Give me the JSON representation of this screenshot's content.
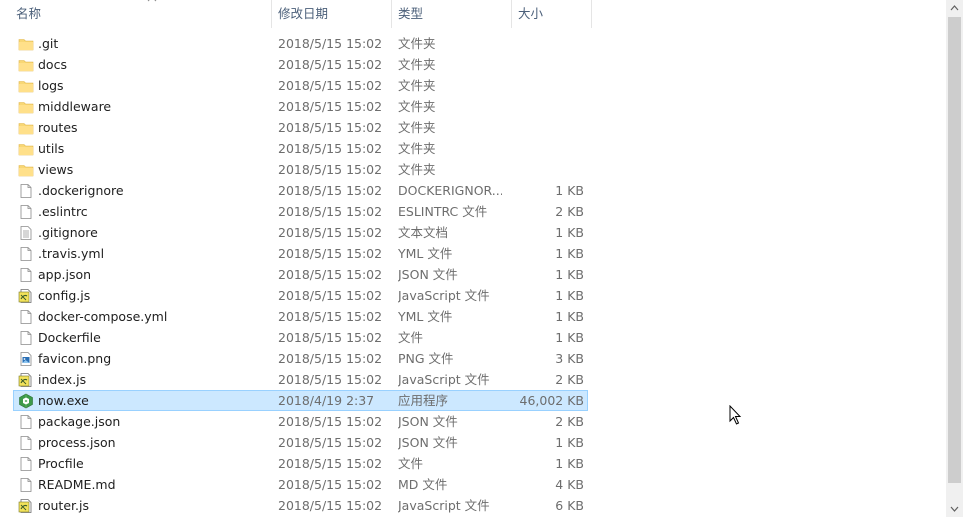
{
  "columns": {
    "name": "名称",
    "modified": "修改日期",
    "type": "类型",
    "size": "大小"
  },
  "files": [
    {
      "name": ".git",
      "modified": "2018/5/15 15:02",
      "type": "文件夹",
      "size": "",
      "icon": "folder-icon"
    },
    {
      "name": "docs",
      "modified": "2018/5/15 15:02",
      "type": "文件夹",
      "size": "",
      "icon": "folder-icon"
    },
    {
      "name": "logs",
      "modified": "2018/5/15 15:02",
      "type": "文件夹",
      "size": "",
      "icon": "folder-icon"
    },
    {
      "name": "middleware",
      "modified": "2018/5/15 15:02",
      "type": "文件夹",
      "size": "",
      "icon": "folder-icon"
    },
    {
      "name": "routes",
      "modified": "2018/5/15 15:02",
      "type": "文件夹",
      "size": "",
      "icon": "folder-icon"
    },
    {
      "name": "utils",
      "modified": "2018/5/15 15:02",
      "type": "文件夹",
      "size": "",
      "icon": "folder-icon"
    },
    {
      "name": "views",
      "modified": "2018/5/15 15:02",
      "type": "文件夹",
      "size": "",
      "icon": "folder-icon"
    },
    {
      "name": ".dockerignore",
      "modified": "2018/5/15 15:02",
      "type": "DOCKERIGNOR...",
      "size": "1 KB",
      "icon": "blank-file-icon"
    },
    {
      "name": ".eslintrc",
      "modified": "2018/5/15 15:02",
      "type": "ESLINTRC 文件",
      "size": "2 KB",
      "icon": "blank-file-icon"
    },
    {
      "name": ".gitignore",
      "modified": "2018/5/15 15:02",
      "type": "文本文档",
      "size": "1 KB",
      "icon": "text-file-icon"
    },
    {
      "name": ".travis.yml",
      "modified": "2018/5/15 15:02",
      "type": "YML 文件",
      "size": "1 KB",
      "icon": "blank-file-icon"
    },
    {
      "name": "app.json",
      "modified": "2018/5/15 15:02",
      "type": "JSON 文件",
      "size": "1 KB",
      "icon": "blank-file-icon"
    },
    {
      "name": "config.js",
      "modified": "2018/5/15 15:02",
      "type": "JavaScript 文件",
      "size": "1 KB",
      "icon": "js-file-icon"
    },
    {
      "name": "docker-compose.yml",
      "modified": "2018/5/15 15:02",
      "type": "YML 文件",
      "size": "1 KB",
      "icon": "blank-file-icon"
    },
    {
      "name": "Dockerfile",
      "modified": "2018/5/15 15:02",
      "type": "文件",
      "size": "1 KB",
      "icon": "blank-file-icon"
    },
    {
      "name": "favicon.png",
      "modified": "2018/5/15 15:02",
      "type": "PNG 文件",
      "size": "3 KB",
      "icon": "image-file-icon"
    },
    {
      "name": "index.js",
      "modified": "2018/5/15 15:02",
      "type": "JavaScript 文件",
      "size": "2 KB",
      "icon": "js-file-icon"
    },
    {
      "name": "now.exe",
      "modified": "2018/4/19 2:37",
      "type": "应用程序",
      "size": "46,002 KB",
      "icon": "exe-icon",
      "selected": true
    },
    {
      "name": "package.json",
      "modified": "2018/5/15 15:02",
      "type": "JSON 文件",
      "size": "2 KB",
      "icon": "blank-file-icon"
    },
    {
      "name": "process.json",
      "modified": "2018/5/15 15:02",
      "type": "JSON 文件",
      "size": "1 KB",
      "icon": "blank-file-icon"
    },
    {
      "name": "Procfile",
      "modified": "2018/5/15 15:02",
      "type": "文件",
      "size": "1 KB",
      "icon": "blank-file-icon"
    },
    {
      "name": "README.md",
      "modified": "2018/5/15 15:02",
      "type": "MD 文件",
      "size": "4 KB",
      "icon": "blank-file-icon"
    },
    {
      "name": "router.js",
      "modified": "2018/5/15 15:02",
      "type": "JavaScript 文件",
      "size": "6 KB",
      "icon": "js-file-icon"
    }
  ],
  "colors": {
    "selection_bg": "#cce8ff",
    "selection_border": "#99d1ff",
    "folder": "#f8d775",
    "header_text": "#4c607a"
  }
}
